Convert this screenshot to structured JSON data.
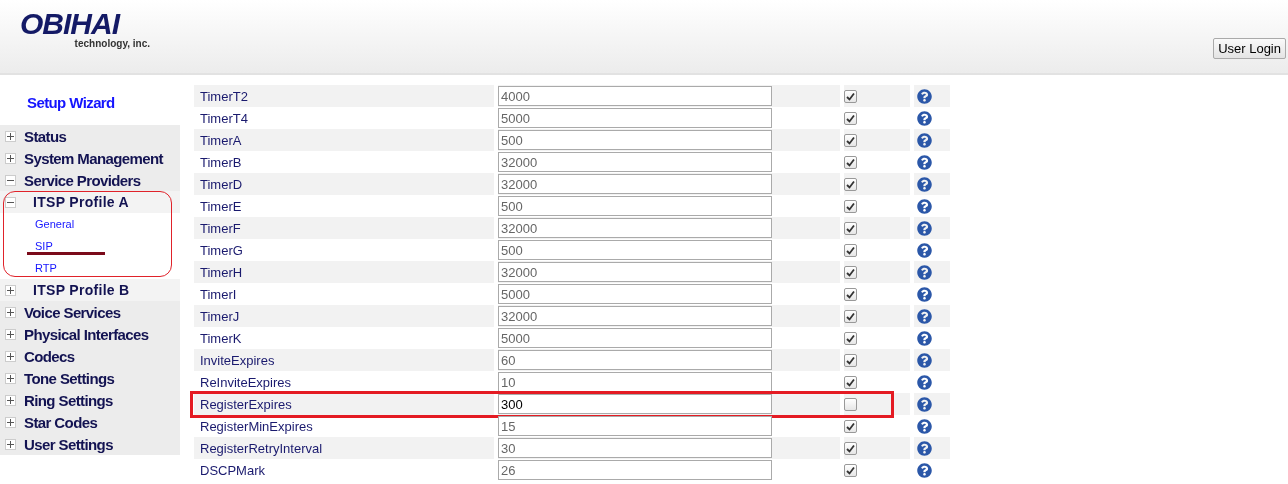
{
  "header": {
    "logo": "OBIHAI",
    "tagline": "technology, inc.",
    "login_button": "User Login"
  },
  "sidebar": {
    "setup_wizard": "Setup Wizard",
    "items": [
      {
        "label": "Status",
        "expanded": false,
        "outlined": false
      },
      {
        "label": "System Management",
        "expanded": false,
        "outlined": false
      },
      {
        "label": "Service Providers",
        "expanded": true,
        "outlined": false,
        "children": [
          {
            "label": "ITSP Profile A",
            "expanded": true,
            "outlined": true,
            "children": [
              {
                "label": "General",
                "underlined": false
              },
              {
                "label": "SIP",
                "underlined": true
              },
              {
                "label": "RTP",
                "underlined": false
              }
            ]
          },
          {
            "label": "ITSP Profile B",
            "expanded": false,
            "outlined": false
          }
        ]
      },
      {
        "label": "Voice Services",
        "expanded": false,
        "outlined": false
      },
      {
        "label": "Physical Interfaces",
        "expanded": false,
        "outlined": false
      },
      {
        "label": "Codecs",
        "expanded": false,
        "outlined": false
      },
      {
        "label": "Tone Settings",
        "expanded": false,
        "outlined": false
      },
      {
        "label": "Ring Settings",
        "expanded": false,
        "outlined": false
      },
      {
        "label": "Star Codes",
        "expanded": false,
        "outlined": false
      },
      {
        "label": "User Settings",
        "expanded": false,
        "outlined": false
      }
    ]
  },
  "settings": [
    {
      "name": "TimerT2",
      "value": "4000",
      "default": true,
      "outlined": false
    },
    {
      "name": "TimerT4",
      "value": "5000",
      "default": true,
      "outlined": false
    },
    {
      "name": "TimerA",
      "value": "500",
      "default": true,
      "outlined": false
    },
    {
      "name": "TimerB",
      "value": "32000",
      "default": true,
      "outlined": false
    },
    {
      "name": "TimerD",
      "value": "32000",
      "default": true,
      "outlined": false
    },
    {
      "name": "TimerE",
      "value": "500",
      "default": true,
      "outlined": false
    },
    {
      "name": "TimerF",
      "value": "32000",
      "default": true,
      "outlined": false
    },
    {
      "name": "TimerG",
      "value": "500",
      "default": true,
      "outlined": false
    },
    {
      "name": "TimerH",
      "value": "32000",
      "default": true,
      "outlined": false
    },
    {
      "name": "TimerI",
      "value": "5000",
      "default": true,
      "outlined": false
    },
    {
      "name": "TimerJ",
      "value": "32000",
      "default": true,
      "outlined": false
    },
    {
      "name": "TimerK",
      "value": "5000",
      "default": true,
      "outlined": false
    },
    {
      "name": "InviteExpires",
      "value": "60",
      "default": true,
      "outlined": false
    },
    {
      "name": "ReInviteExpires",
      "value": "10",
      "default": true,
      "outlined": false
    },
    {
      "name": "RegisterExpires",
      "value": "300",
      "default": false,
      "outlined": true
    },
    {
      "name": "RegisterMinExpires",
      "value": "15",
      "default": true,
      "outlined": false
    },
    {
      "name": "RegisterRetryInterval",
      "value": "30",
      "default": true,
      "outlined": false
    },
    {
      "name": "DSCPMark",
      "value": "26",
      "default": true,
      "outlined": false
    }
  ]
}
